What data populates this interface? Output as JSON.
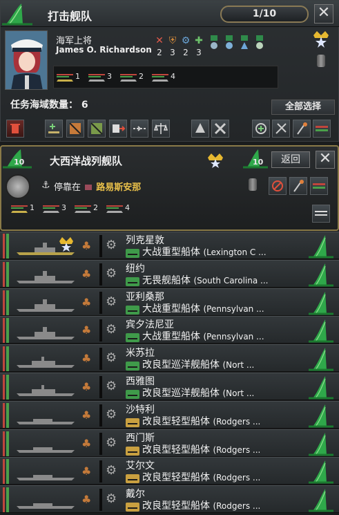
{
  "top_fleet": {
    "title": "打击舰队",
    "count": "1/10",
    "close": "✕",
    "rank": "海军上将",
    "admiral_name": "James O. Richardson",
    "skills": [
      {
        "icon": "crossed-swords-icon",
        "value": "2",
        "color": "#e05a4a"
      },
      {
        "icon": "shield-icon",
        "value": "3",
        "color": "#d58b3b"
      },
      {
        "icon": "gear-icon",
        "value": "2",
        "color": "#6aa4d6"
      },
      {
        "icon": "puzzle-icon",
        "value": "3",
        "color": "#6cc06a"
      }
    ],
    "ship_counts": [
      {
        "type": "ACR",
        "count": "1"
      },
      {
        "type": "BB",
        "count": "3"
      },
      {
        "type": "C",
        "count": "2"
      },
      {
        "type": "DD",
        "count": "4"
      }
    ],
    "region_label": "任务海域数量： 6",
    "select_all": "全部选择"
  },
  "atlantic_fleet": {
    "title": "大西洋战列舰队",
    "left_badge": "10",
    "right_badge": "10",
    "return": "返回",
    "close": "✕",
    "dock_prefix": "停靠在",
    "dock_location": "路易斯安那",
    "ship_counts": [
      {
        "type": "ACR",
        "count": "1"
      },
      {
        "type": "BB",
        "count": "3"
      },
      {
        "type": "C",
        "count": "2"
      },
      {
        "type": "DD",
        "count": "4"
      }
    ]
  },
  "ships": [
    {
      "name": "列克星敦",
      "class": "大战重型船体",
      "class_en": "(Lexington C ...",
      "type": "ACR",
      "flagship": true,
      "class_icon": "battleship-icon"
    },
    {
      "name": "纽约",
      "class": "无畏舰船体",
      "class_en": "(South Carolina ...",
      "type": "BC",
      "flagship": false,
      "class_icon": "battleship-icon"
    },
    {
      "name": "亚利桑那",
      "class": "大战重型船体",
      "class_en": "(Pennsylvan ...",
      "type": "BC",
      "flagship": false,
      "class_icon": "battleship-icon"
    },
    {
      "name": "宾夕法尼亚",
      "class": "大战重型船体",
      "class_en": "(Pennsylvan ...",
      "type": "BC",
      "flagship": false,
      "class_icon": "battleship-icon"
    },
    {
      "name": "米苏拉",
      "class": "改良型巡洋舰船体",
      "class_en": "(Nort ...",
      "type": "C",
      "flagship": false,
      "class_icon": "cruiser-icon"
    },
    {
      "name": "西雅图",
      "class": "改良型巡洋舰船体",
      "class_en": "(Nort ...",
      "type": "C",
      "flagship": false,
      "class_icon": "cruiser-icon"
    },
    {
      "name": "沙特利",
      "class": "改良型轻型船体",
      "class_en": "(Rodgers ...",
      "type": "DD",
      "flagship": false,
      "class_icon": "destroyer-icon"
    },
    {
      "name": "西门斯",
      "class": "改良型轻型船体",
      "class_en": "(Rodgers ...",
      "type": "DD",
      "flagship": false,
      "class_icon": "destroyer-icon"
    },
    {
      "name": "艾尔文",
      "class": "改良型轻型船体",
      "class_en": "(Rodgers ...",
      "type": "DD",
      "flagship": false,
      "class_icon": "destroyer-icon"
    },
    {
      "name": "戴尔",
      "class": "改良型轻型船体",
      "class_en": "(Rodgers ...",
      "type": "DD",
      "flagship": false,
      "class_icon": "destroyer-icon"
    }
  ]
}
